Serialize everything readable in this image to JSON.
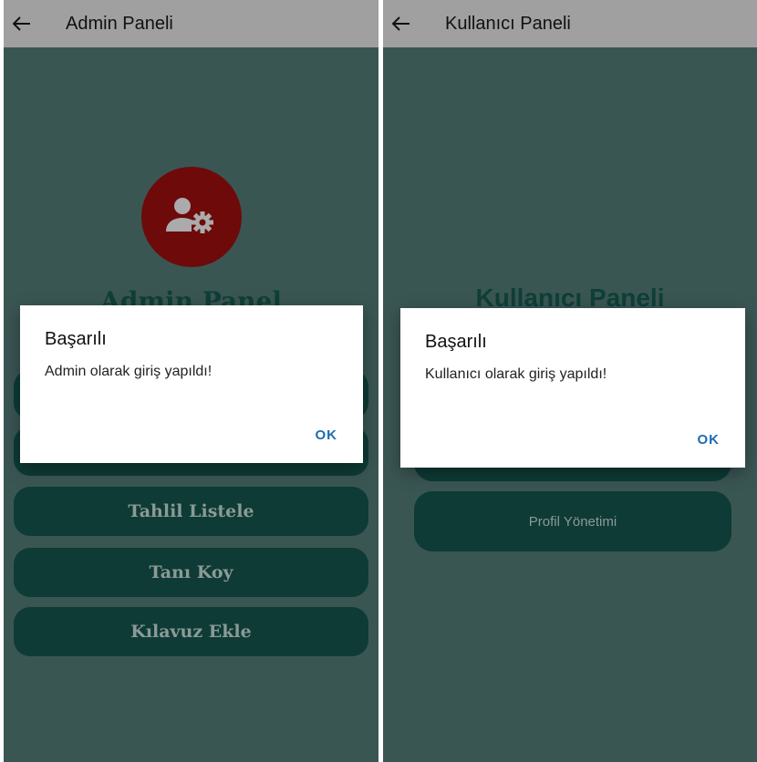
{
  "left": {
    "appbar": {
      "back_icon": "arrow-left-icon",
      "title": "Admin Paneli"
    },
    "avatar": {
      "icon": "admin-settings-icon",
      "color": "#6e0a0a"
    },
    "heading": "Admin Panel",
    "buttons": [
      "",
      "",
      "Tahlil Listele",
      "Tanı Koy",
      "Kılavuz Ekle"
    ],
    "dialog": {
      "title": "Başarılı",
      "message": "Admin olarak giriş yapıldı!",
      "ok": "OK"
    }
  },
  "right": {
    "appbar": {
      "back_icon": "arrow-left-icon",
      "title": "Kullanıcı Paneli"
    },
    "heading": "Kullanıcı Paneli",
    "buttons": [
      "",
      "Profil Yönetimi"
    ],
    "dialog": {
      "title": "Başarılı",
      "message": "Kullanıcı olarak giriş yapıldı!",
      "ok": "OK"
    }
  },
  "colors": {
    "appbar": "#a0a0a0",
    "scrim_background": "#3a5653",
    "button": "#0e3b35",
    "ok_accent": "#1c6bb4"
  }
}
